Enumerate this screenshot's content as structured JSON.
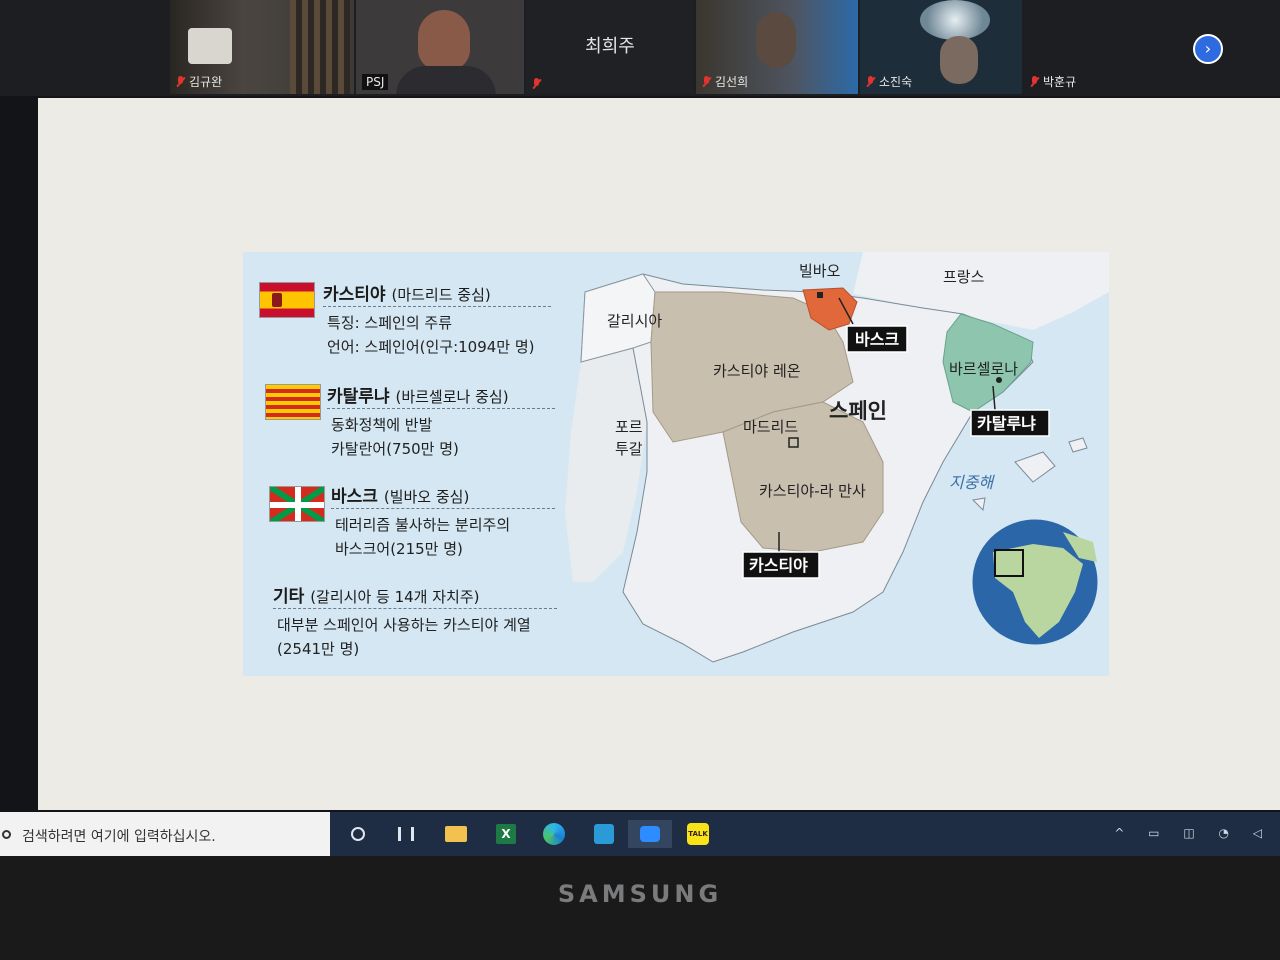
{
  "meeting": {
    "participants": [
      {
        "name": "김규완",
        "muted": true
      },
      {
        "name": "PSJ",
        "muted": false
      },
      {
        "name": "최희주",
        "muted": true
      },
      {
        "name": "김선희",
        "muted": true
      },
      {
        "name": "소진숙",
        "muted": true
      },
      {
        "name": "박훈규",
        "muted": true
      }
    ],
    "next_page_icon": "chevron-right-icon"
  },
  "slide": {
    "legend": [
      {
        "title": "카스티야",
        "sub": "(마드리드 중심)",
        "lines": [
          "특징: 스페인의 주류",
          "언어: 스페인어(인구:1094만 명)"
        ],
        "flag": "spain"
      },
      {
        "title": "카탈루냐",
        "sub": "(바르셀로나 중심)",
        "lines": [
          "동화정책에 반발",
          "카탈란어(750만 명)"
        ],
        "flag": "catalonia"
      },
      {
        "title": "바스크",
        "sub": "(빌바오 중심)",
        "lines": [
          "테러리즘 불사하는 분리주의",
          "바스크어(215만 명)"
        ],
        "flag": "basque"
      },
      {
        "title": "기타",
        "sub": "(갈리시아 등 14개 자치주)",
        "lines": [
          "대부분 스페인어 사용하는 카스티야 계열",
          "(2541만 명)"
        ],
        "flag": ""
      }
    ],
    "map": {
      "bilbao": "빌바오",
      "france": "프랑스",
      "galicia": "갈리시아",
      "basque": "바스크",
      "castilla_leon": "카스티야 레온",
      "barcelona": "바르셀로나",
      "portugal_1": "포르",
      "portugal_2": "투갈",
      "madrid": "마드리드",
      "spain": "스페인",
      "catalonia": "카탈루냐",
      "mediterranean": "지중해",
      "castilla_la_mancha": "카스티야-라 만사",
      "castilla": "카스티야"
    },
    "colors": {
      "castilla": "#c9bfae",
      "basque": "#e0683a",
      "catalonia": "#8ec5ae",
      "land": "#eef0f3",
      "sea": "#d4e7f2"
    }
  },
  "taskbar": {
    "search_placeholder": "검색하려면 여기에 입력하십시오.",
    "icons": [
      "cortana-icon",
      "task-view-icon",
      "file-explorer-icon",
      "excel-icon",
      "edge-icon",
      "hwp-icon",
      "zoom-icon",
      "kakaotalk-icon"
    ],
    "kakaotalk_label": "TALK"
  },
  "device": {
    "brand": "SAMSUNG"
  }
}
